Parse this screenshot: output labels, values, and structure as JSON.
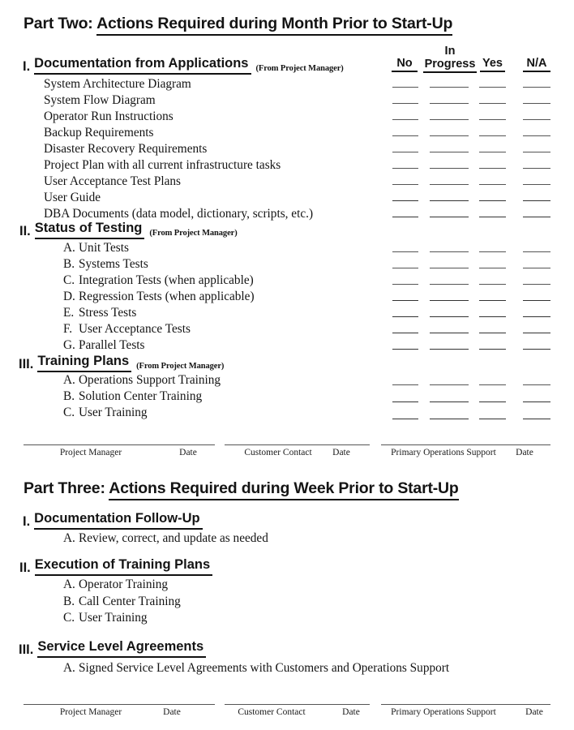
{
  "document": {
    "columns": {
      "no": "No",
      "in": "In",
      "progress": "Progress",
      "yes": "Yes",
      "na": "N/A"
    },
    "from_project_manager": "(From Project Manager)",
    "signature_labels": {
      "project_manager": "Project Manager",
      "date": "Date",
      "customer_contact": "Customer Contact",
      "primary_operations_support": "Primary Operations Support"
    },
    "part_two": {
      "label": "Part Two:",
      "title": "Actions Required during Month Prior to Start-Up",
      "sections": [
        {
          "num": "I.",
          "heading": "Documentation from Applications",
          "note": "(From Project Manager)",
          "items": [
            {
              "letter": "",
              "text": "System Architecture Diagram"
            },
            {
              "letter": "",
              "text": "System Flow Diagram"
            },
            {
              "letter": "",
              "text": "Operator Run Instructions"
            },
            {
              "letter": "",
              "text": "Backup Requirements"
            },
            {
              "letter": "",
              "text": "Disaster Recovery Requirements"
            },
            {
              "letter": "",
              "text": "Project Plan with all current infrastructure tasks"
            },
            {
              "letter": "",
              "text": "User Acceptance Test Plans"
            },
            {
              "letter": "",
              "text": "User Guide"
            },
            {
              "letter": "",
              "text": "DBA Documents (data model, dictionary, scripts, etc.)"
            }
          ]
        },
        {
          "num": "II.",
          "heading": "Status of Testing",
          "note": "(From Project Manager)",
          "items": [
            {
              "letter": "A.",
              "text": "Unit Tests"
            },
            {
              "letter": "B.",
              "text": "Systems Tests"
            },
            {
              "letter": "C.",
              "text": "Integration Tests (when applicable)"
            },
            {
              "letter": "D.",
              "text": "Regression Tests (when applicable)"
            },
            {
              "letter": "E.",
              "text": "Stress Tests"
            },
            {
              "letter": "F.",
              "text": "User Acceptance Tests"
            },
            {
              "letter": "G.",
              "text": "Parallel Tests"
            }
          ]
        },
        {
          "num": "III.",
          "heading": "Training Plans",
          "note": "(From Project Manager)",
          "items": [
            {
              "letter": "A.",
              "text": "Operations Support Training"
            },
            {
              "letter": "B.",
              "text": "Solution Center Training"
            },
            {
              "letter": "C.",
              "text": "User Training"
            }
          ]
        }
      ]
    },
    "part_three": {
      "label": "Part Three:",
      "title": "Actions Required during Week Prior to Start-Up",
      "sections": [
        {
          "num": "I.",
          "heading": "Documentation Follow-Up",
          "note": "",
          "items": [
            {
              "letter": "A.",
              "text": "Review, correct, and update as needed"
            }
          ]
        },
        {
          "num": "II.",
          "heading": "Execution of Training Plans",
          "note": "",
          "items": [
            {
              "letter": "A.",
              "text": "Operator Training"
            },
            {
              "letter": "B.",
              "text": "Call Center Training"
            },
            {
              "letter": "C.",
              "text": "User Training"
            }
          ]
        },
        {
          "num": "III.",
          "heading": "Service Level Agreements",
          "note": "",
          "items": [
            {
              "letter": "A.",
              "text": "Signed Service Level Agreements with Customers and Operations Support"
            }
          ]
        }
      ]
    }
  }
}
